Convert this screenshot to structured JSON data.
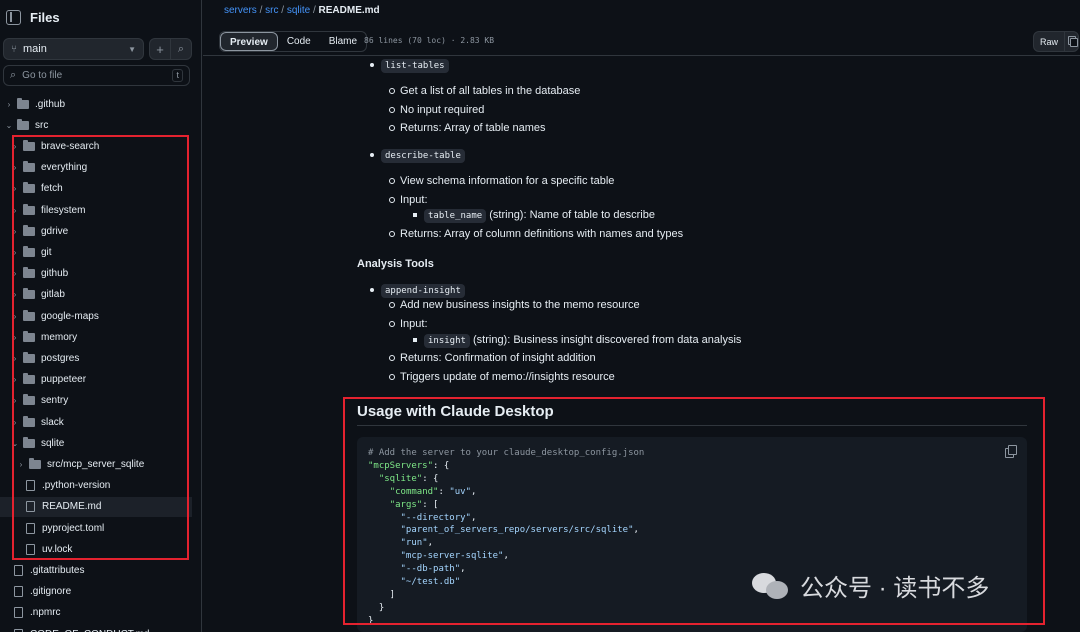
{
  "sidebar": {
    "title": "Files",
    "branch": "main",
    "goto_placeholder": "Go to file",
    "goto_shortcut": "t",
    "tree": [
      {
        "label": ".github",
        "type": "folder",
        "chev": "›"
      },
      {
        "label": "src",
        "type": "folder",
        "chev": "⌄"
      },
      {
        "label": "brave-search",
        "type": "folder",
        "chev": "›"
      },
      {
        "label": "everything",
        "type": "folder",
        "chev": "›"
      },
      {
        "label": "fetch",
        "type": "folder",
        "chev": "›"
      },
      {
        "label": "filesystem",
        "type": "folder",
        "chev": "›"
      },
      {
        "label": "gdrive",
        "type": "folder",
        "chev": "›"
      },
      {
        "label": "git",
        "type": "folder",
        "chev": "›"
      },
      {
        "label": "github",
        "type": "folder",
        "chev": "›"
      },
      {
        "label": "gitlab",
        "type": "folder",
        "chev": "›"
      },
      {
        "label": "google-maps",
        "type": "folder",
        "chev": "›"
      },
      {
        "label": "memory",
        "type": "folder",
        "chev": "›"
      },
      {
        "label": "postgres",
        "type": "folder",
        "chev": "›"
      },
      {
        "label": "puppeteer",
        "type": "folder",
        "chev": "›"
      },
      {
        "label": "sentry",
        "type": "folder",
        "chev": "›"
      },
      {
        "label": "slack",
        "type": "folder",
        "chev": "›"
      },
      {
        "label": "sqlite",
        "type": "folder",
        "chev": "⌄"
      },
      {
        "label": "src/mcp_server_sqlite",
        "type": "folder",
        "chev": "›"
      },
      {
        "label": ".python-version",
        "type": "file"
      },
      {
        "label": "README.md",
        "type": "file",
        "selected": true
      },
      {
        "label": "pyproject.toml",
        "type": "file"
      },
      {
        "label": "uv.lock",
        "type": "file"
      },
      {
        "label": ".gitattributes",
        "type": "file"
      },
      {
        "label": ".gitignore",
        "type": "file"
      },
      {
        "label": ".npmrc",
        "type": "file"
      },
      {
        "label": "CODE_OF_CONDUCT.md",
        "type": "file"
      }
    ]
  },
  "breadcrumb": {
    "repo": "servers",
    "sep": "/",
    "dir1": "src",
    "dir2": "sqlite",
    "file": "README.md"
  },
  "toolbar": {
    "tabs": [
      "Preview",
      "Code",
      "Blame"
    ],
    "file_info": "86 lines (70 loc) · 2.83 KB",
    "raw_label": "Raw"
  },
  "readme": {
    "list_tables": {
      "code": "list-tables",
      "items": [
        "Get a list of all tables in the database",
        "No input required",
        "Returns: Array of table names"
      ]
    },
    "describe_table": {
      "code": "describe-table",
      "item1": "View schema information for a specific table",
      "item2": "Input:",
      "param_code": "table_name",
      "param_desc": "(string): Name of table to describe",
      "item3": "Returns: Array of column definitions with names and types"
    },
    "analysis_heading": "Analysis Tools",
    "append_insight": {
      "code": "append-insight",
      "item1": "Add new business insights to the memo resource",
      "item2": "Input:",
      "param_code": "insight",
      "param_desc": "(string): Business insight discovered from data analysis",
      "item3": "Returns: Confirmation of insight addition",
      "item4": "Triggers update of memo://insights resource"
    },
    "usage_heading": "Usage with Claude Desktop",
    "code_lines": [
      "# Add the server to your claude_desktop_config.json",
      "\"mcpServers\": {",
      "  \"sqlite\": {",
      "    \"command\": \"uv\",",
      "    \"args\": [",
      "      \"--directory\",",
      "      \"parent_of_servers_repo/servers/src/sqlite\",",
      "      \"run\",",
      "      \"mcp-server-sqlite\",",
      "      \"--db-path\",",
      "      \"~/test.db\"",
      "    ]",
      "  }",
      "}"
    ]
  },
  "watermark": "公众号 · 读书不多",
  "colors": {
    "highlight_box": "#e4222f",
    "link": "#4493f8",
    "background": "#0d1117"
  }
}
